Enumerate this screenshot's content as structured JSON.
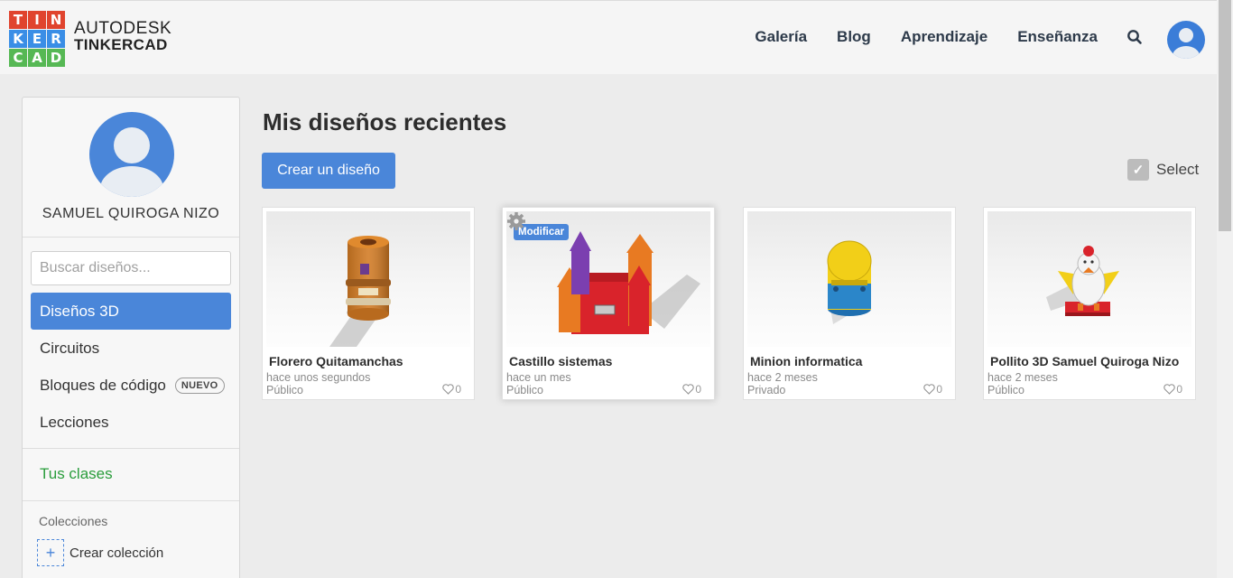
{
  "header": {
    "logo_letters": [
      "T",
      "I",
      "N",
      "K",
      "E",
      "R",
      "C",
      "A",
      "D"
    ],
    "logo_colors": [
      "#e0442e",
      "#e0442e",
      "#e0442e",
      "#3a8ee6",
      "#3a8ee6",
      "#3a8ee6",
      "#56b854",
      "#56b854",
      "#56b854"
    ],
    "brand_line1": "AUTODESK",
    "brand_line2": "TINKERCAD",
    "nav": [
      "Galería",
      "Blog",
      "Aprendizaje",
      "Enseñanza"
    ],
    "search_icon": "search-icon",
    "avatar_icon": "user-avatar-icon"
  },
  "sidebar": {
    "username": "SAMUEL QUIROGA NIZO",
    "search_placeholder": "Buscar diseños...",
    "items": [
      {
        "label": "Diseños 3D",
        "active": true
      },
      {
        "label": "Circuitos"
      },
      {
        "label": "Bloques de código",
        "badge": "NUEVO"
      },
      {
        "label": "Lecciones"
      }
    ],
    "classes_label": "Tus clases",
    "collections_title": "Colecciones",
    "create_collection": "Crear colección"
  },
  "main": {
    "title": "Mis diseños recientes",
    "create_button": "Crear un diseño",
    "select_label": "Select",
    "accent": "#4a86d9",
    "cards": [
      {
        "title": "Florero Quitamanchas",
        "time": "hace unos segundos",
        "visibility": "Público",
        "likes": "0"
      },
      {
        "title": "Castillo sistemas",
        "time": "hace un mes",
        "visibility": "Público",
        "likes": "0",
        "badge": "Modificar"
      },
      {
        "title": "Minion informatica",
        "time": "hace 2 meses",
        "visibility": "Privado",
        "likes": "0"
      },
      {
        "title": "Pollito 3D Samuel Quiroga Nizo",
        "time": "hace 2 meses",
        "visibility": "Público",
        "likes": "0"
      }
    ]
  }
}
